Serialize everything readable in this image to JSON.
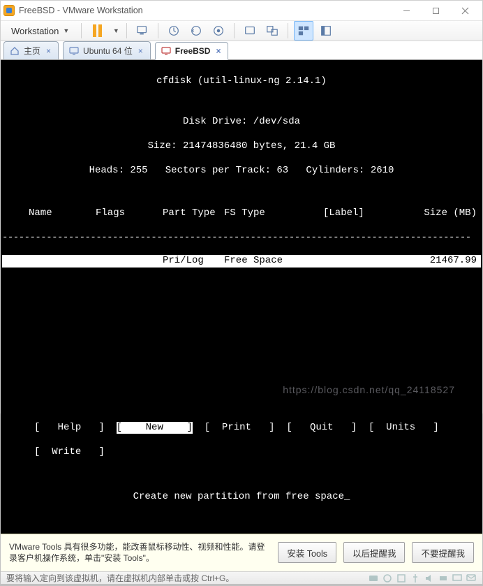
{
  "window": {
    "title": "FreeBSD - VMware Workstation"
  },
  "toolbar": {
    "menu_label": "Workstation"
  },
  "tabs": [
    {
      "label": "主页",
      "active": false
    },
    {
      "label": "Ubuntu 64 位",
      "active": false
    },
    {
      "label": "FreeBSD",
      "active": true
    }
  ],
  "cfdisk": {
    "title": "cfdisk (util-linux-ng 2.14.1)",
    "drive_line": "Disk Drive: /dev/sda",
    "size_line": "Size: 21474836480 bytes, 21.4 GB",
    "geom_line": "Heads: 255   Sectors per Track: 63   Cylinders: 2610",
    "columns": {
      "name": "Name",
      "flags": "Flags",
      "part_type": "Part Type",
      "fs_type": "FS Type",
      "label": "[Label]",
      "size": "Size (MB)"
    },
    "row": {
      "part_type": "Pri/Log",
      "fs_type": "Free Space",
      "size": "21467.99"
    },
    "menu": {
      "help": "Help",
      "new": "New",
      "print": "Print",
      "quit": "Quit",
      "units": "Units",
      "write": "Write"
    },
    "hint": "Create new partition from free space_"
  },
  "info": {
    "text": "VMware Tools 具有很多功能，能改善鼠标移动性、视频和性能。请登录客户机操作系统，单击\"安装 Tools\"。",
    "install": "安装 Tools",
    "later": "以后提醒我",
    "never": "不要提醒我"
  },
  "status": {
    "msg": "要将输入定向到该虚拟机，请在虚拟机内部单击或按 Ctrl+G。"
  },
  "watermark": "https://blog.csdn.net/qq_24118527"
}
